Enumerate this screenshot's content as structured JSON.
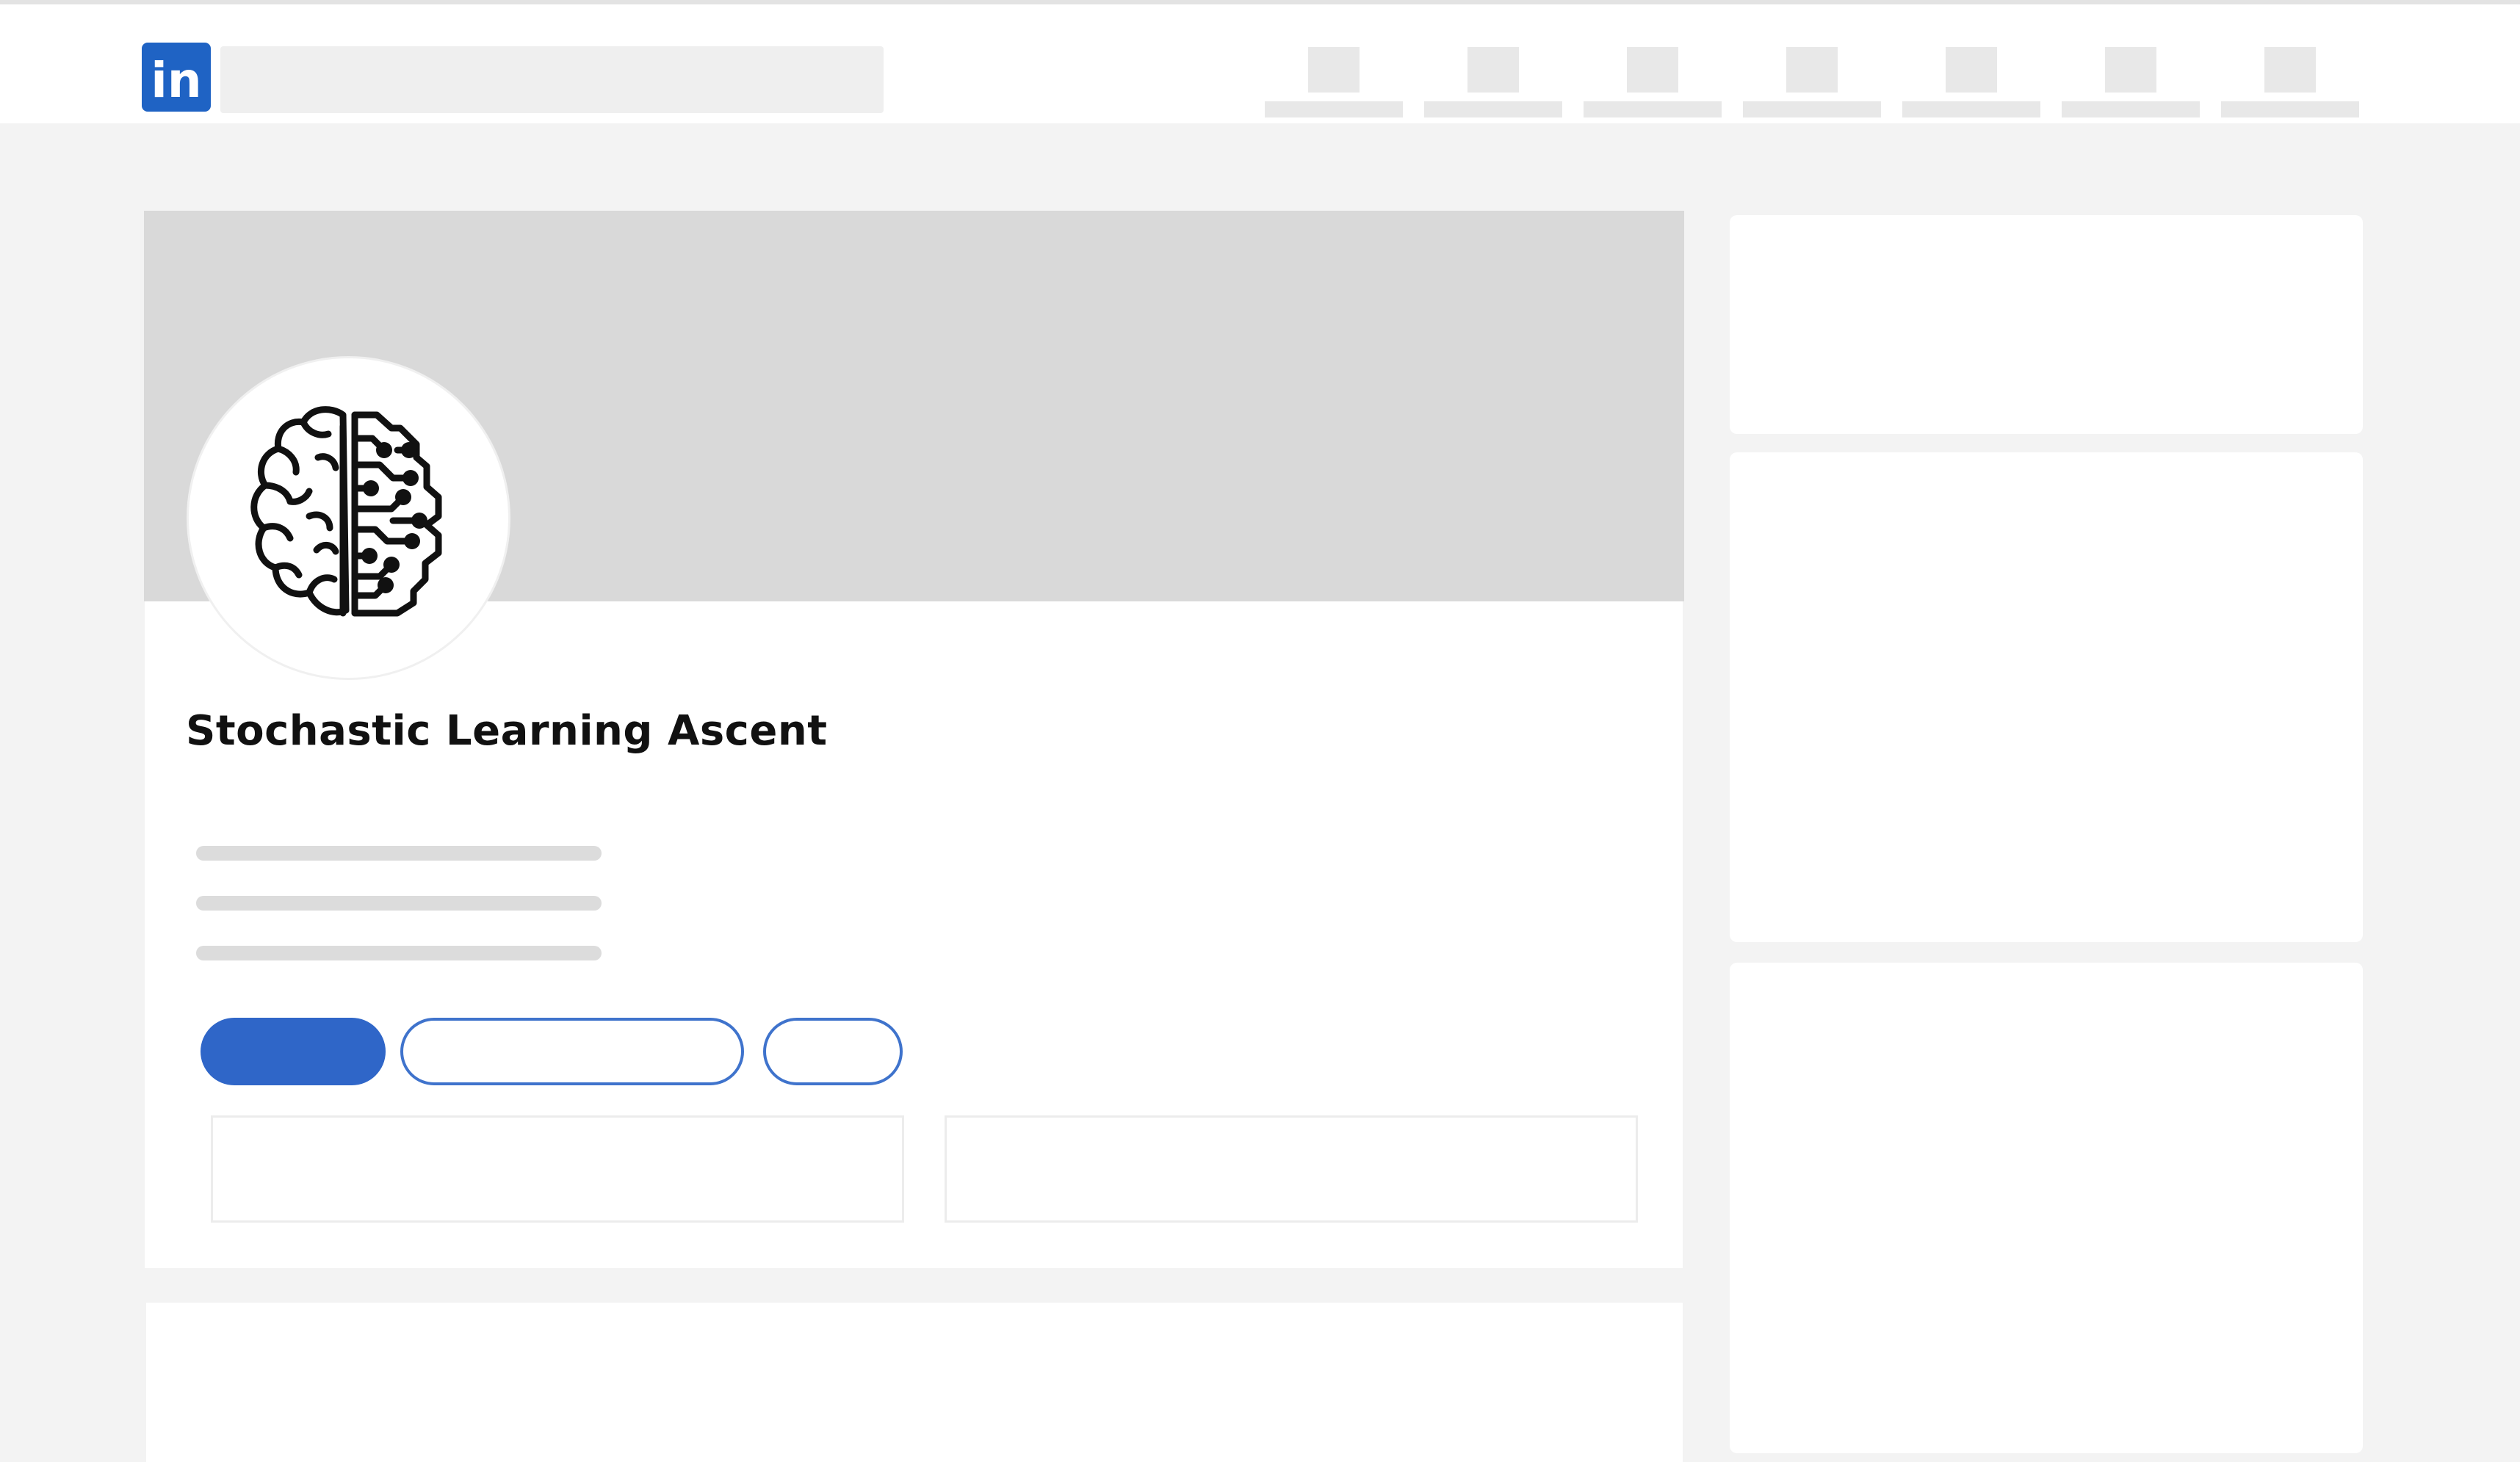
{
  "header": {
    "logo_text": "in",
    "logo_color": "#1f63c4",
    "nav_item_count": 7
  },
  "profile": {
    "avatar_icon": "brain-circuit-icon",
    "name": "Stochastic Learning Ascent"
  },
  "colors": {
    "accent": "#2f66c8",
    "cover": "#d9d9d9",
    "page_background": "#f3f3f3"
  }
}
